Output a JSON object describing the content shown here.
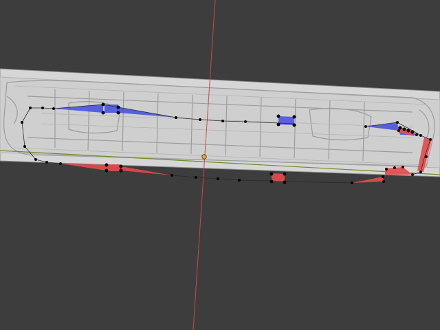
{
  "viewport": {
    "background": "#3d3d3d",
    "plane_color": "#d2d2d2",
    "plane_edge_color": "#9a9a9a",
    "axis_x_color": "#6b8e23",
    "axis_y_color": "#c94a4a",
    "origin_color": "#f5a623",
    "selection_blue": "#4a55e0",
    "selection_red": "#e84b4b",
    "vertex_color": "#000000"
  },
  "icons": {
    "origin": "origin-icon"
  }
}
